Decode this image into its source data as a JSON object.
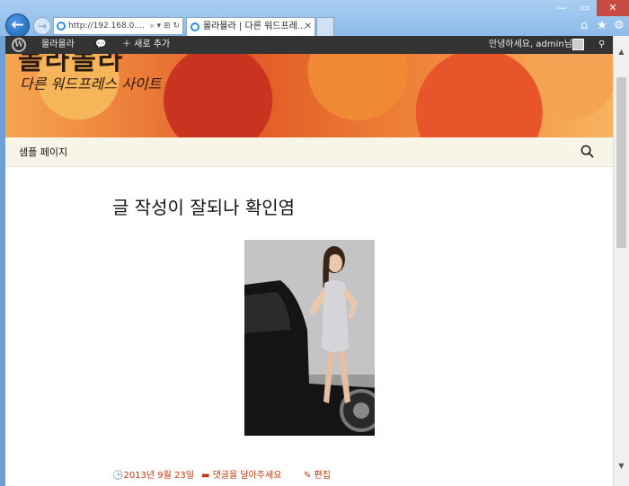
{
  "browser": {
    "address": "http://192.168.0....",
    "address_tools": "⌕ ▾ ⊞ ↻",
    "tab_title": "몰라몰라 | 다른 워드프레...",
    "tab_close": "✕",
    "back_glyph": "←",
    "forward_glyph": "→",
    "window_min": "—",
    "window_max": "▭",
    "window_close": "✕",
    "home_glyph": "⌂",
    "star_glyph": "★",
    "gear_glyph": "⚙"
  },
  "adminbar": {
    "logo": "W",
    "site_name": "몰라몰라",
    "comment_glyph": "💬",
    "new_label": "＋ 새로 추가",
    "howdy": "안녕하세요, admin님",
    "search_glyph": "⚲"
  },
  "header": {
    "title_fragment": "몰라몰라",
    "tagline": "다른 워드프레스 사이트"
  },
  "nav": {
    "items": [
      {
        "label": "샘플 페이지"
      }
    ]
  },
  "post": {
    "title": "글 작성이 잘되나 확인염",
    "date": "🕒2013년 9월 23일",
    "comments": "▬ 댓글을 달아주세요",
    "edit": "✎ 편집"
  },
  "colors": {
    "adminbar_bg": "#333333",
    "nav_bg": "#f7f5e7",
    "meta_link": "#bc360a",
    "window_frame": "#8dbbe9"
  }
}
